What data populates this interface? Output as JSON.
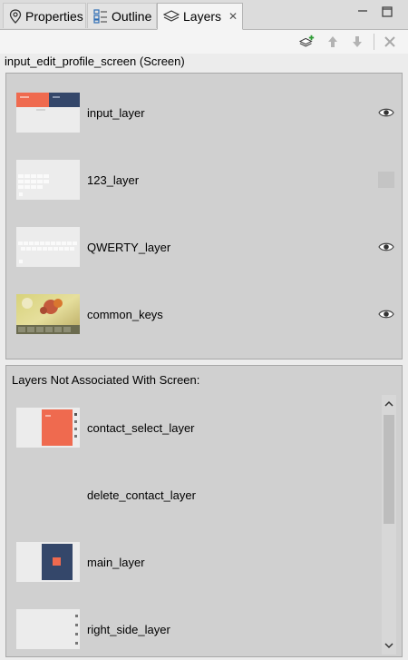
{
  "tabs": [
    {
      "label": "Properties",
      "icon": "location-pin-icon",
      "active": false
    },
    {
      "label": "Outline",
      "icon": "outline-tree-icon",
      "active": false
    },
    {
      "label": "Layers",
      "icon": "layers-icon",
      "active": true
    }
  ],
  "toolbar": {
    "add_layer": "add-layer-icon",
    "move_up": "arrow-up-icon",
    "move_down": "arrow-down-icon",
    "remove": "remove-icon"
  },
  "screen_title": "input_edit_profile_screen (Screen)",
  "screen_layers": [
    {
      "name": "input_layer",
      "visible": true
    },
    {
      "name": "123_layer",
      "visible": false
    },
    {
      "name": "QWERTY_layer",
      "visible": true
    },
    {
      "name": "common_keys",
      "visible": true
    }
  ],
  "unassociated": {
    "title": "Layers Not Associated With Screen:",
    "layers": [
      {
        "name": "contact_select_layer"
      },
      {
        "name": "delete_contact_layer"
      },
      {
        "name": "main_layer"
      },
      {
        "name": "right_side_layer"
      }
    ]
  },
  "colors": {
    "accent_orange": "#ef6a4f",
    "navy": "#34476a"
  }
}
